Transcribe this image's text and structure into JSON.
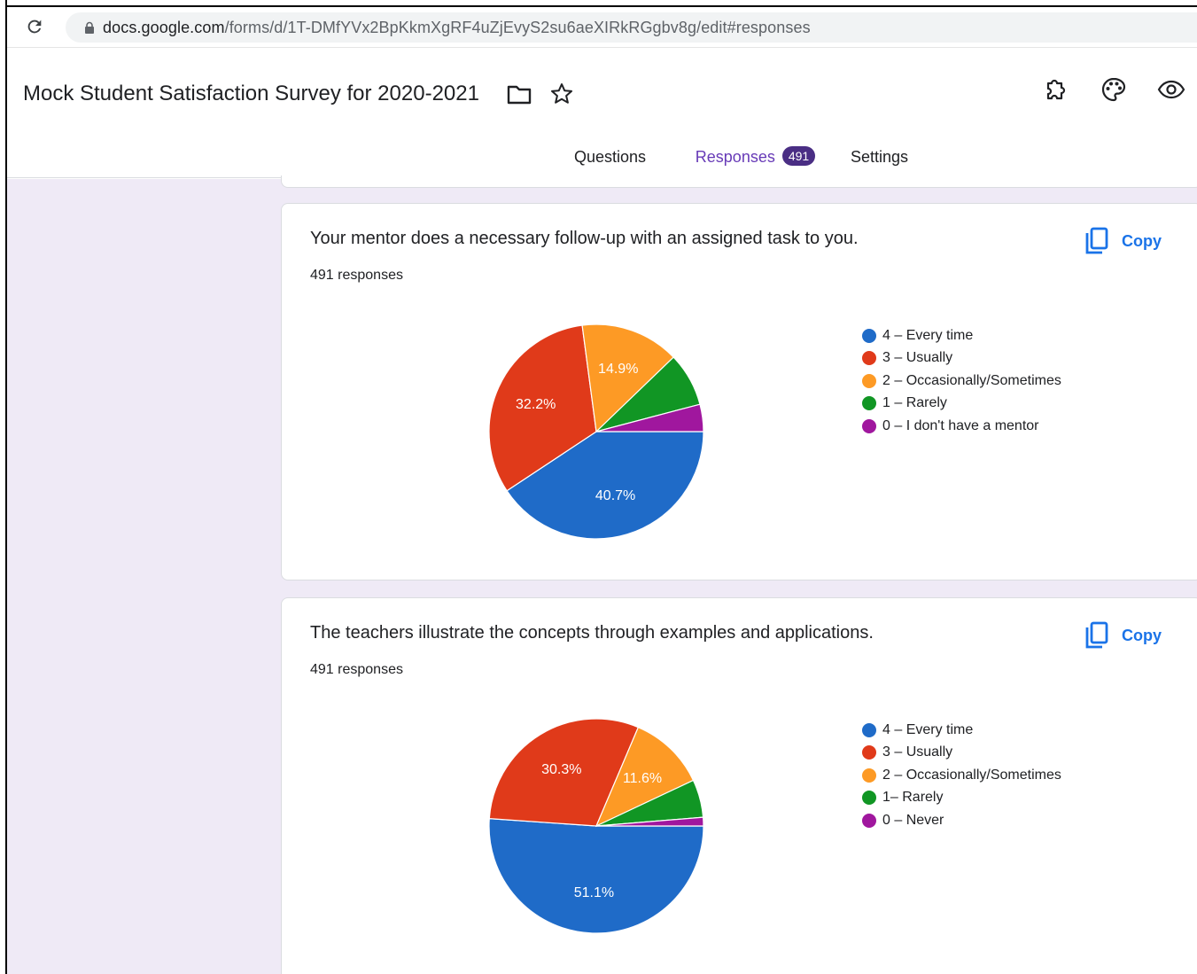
{
  "browser": {
    "url_host": "docs.google.com",
    "url_path": "/forms/d/1T-DMfYVx2BpKkmXgRF4uZjEvyS2su6aeXIRkRGgbv8g/edit#responses"
  },
  "form": {
    "title": "Mock Student Satisfaction Survey for 2020-2021"
  },
  "tabs": {
    "questions": "Questions",
    "responses": "Responses",
    "responses_count": "491",
    "settings": "Settings"
  },
  "colors": {
    "blue": "#1f6bc8",
    "red": "#e03a1a",
    "orange": "#fd9a25",
    "green": "#119624",
    "purple": "#a0179e",
    "accent": "#673ab7",
    "link": "#1a73e8"
  },
  "questions": [
    {
      "title": "Your mentor does a necessary follow-up with an assigned task to you.",
      "responses": "491 responses",
      "copy_label": "Copy"
    },
    {
      "title": "The teachers illustrate the concepts through examples and applications.",
      "responses": "491 responses",
      "copy_label": "Copy"
    }
  ],
  "chart_data": [
    {
      "type": "pie",
      "title": "Your mentor does a necessary follow-up with an assigned task to you.",
      "legend_position": "right",
      "slices": [
        {
          "label": "4 – Every time",
          "value": 40.7,
          "color": "#1f6bc8",
          "data_label": "40.7%"
        },
        {
          "label": "3 – Usually",
          "value": 32.2,
          "color": "#e03a1a",
          "data_label": "32.2%"
        },
        {
          "label": "2 – Occasionally/Sometimes",
          "value": 14.9,
          "color": "#fd9a25",
          "data_label": "14.9%"
        },
        {
          "label": "1 – Rarely",
          "value": 8.1,
          "color": "#119624",
          "data_label": ""
        },
        {
          "label": "0 – I don't have a mentor",
          "value": 4.1,
          "color": "#a0179e",
          "data_label": ""
        }
      ]
    },
    {
      "type": "pie",
      "title": "The teachers illustrate the concepts through examples and applications.",
      "legend_position": "right",
      "slices": [
        {
          "label": "4 – Every time",
          "value": 51.1,
          "color": "#1f6bc8",
          "data_label": "51.1%"
        },
        {
          "label": "3 – Usually",
          "value": 30.3,
          "color": "#e03a1a",
          "data_label": "30.3%"
        },
        {
          "label": "2 – Occasionally/Sometimes",
          "value": 11.6,
          "color": "#fd9a25",
          "data_label": "11.6%"
        },
        {
          "label": "1– Rarely",
          "value": 5.7,
          "color": "#119624",
          "data_label": ""
        },
        {
          "label": "0 – Never",
          "value": 1.3,
          "color": "#a0179e",
          "data_label": ""
        }
      ]
    }
  ]
}
